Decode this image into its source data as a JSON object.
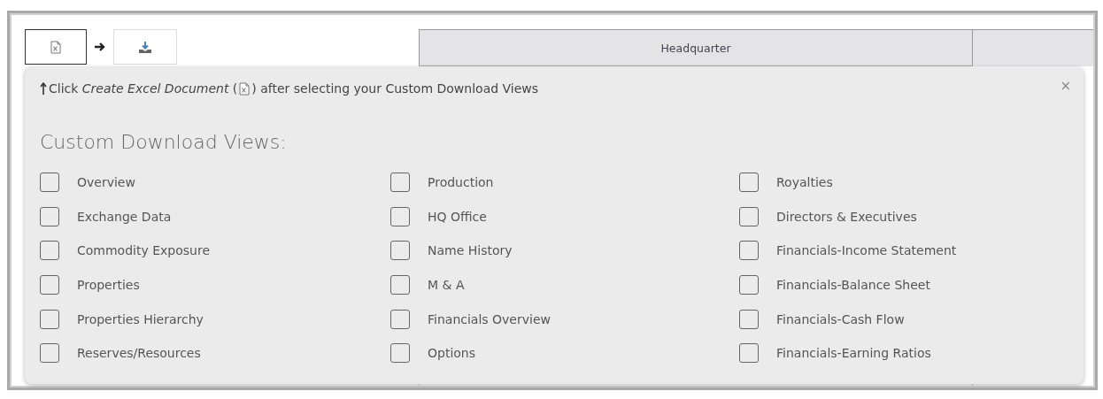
{
  "table": {
    "columns": [
      "Headquarter"
    ]
  },
  "popover": {
    "hint_before": "Click *Create Excel Document* (",
    "hint_after": ") after selecting your Custom Download Views",
    "close": "×",
    "title": "Custom Download Views:",
    "columns": [
      [
        {
          "label": "Overview",
          "checked": false
        },
        {
          "label": "Exchange Data",
          "checked": false
        },
        {
          "label": "Commodity Exposure",
          "checked": false
        },
        {
          "label": "Properties",
          "checked": false
        },
        {
          "label": "Properties Hierarchy",
          "checked": false
        },
        {
          "label": "Reserves/Resources",
          "checked": false
        }
      ],
      [
        {
          "label": "Production",
          "checked": false
        },
        {
          "label": "HQ Office",
          "checked": false
        },
        {
          "label": "Name History",
          "checked": false
        },
        {
          "label": "M & A",
          "checked": false
        },
        {
          "label": "Financials Overview",
          "checked": false
        },
        {
          "label": "Options",
          "checked": false
        }
      ],
      [
        {
          "label": "Royalties",
          "checked": false
        },
        {
          "label": "Directors & Executives",
          "checked": false
        },
        {
          "label": "Financials-Income Statement",
          "checked": false
        },
        {
          "label": "Financials-Balance Sheet",
          "checked": false
        },
        {
          "label": "Financials-Cash Flow",
          "checked": false
        },
        {
          "label": "Financials-Earning Ratios",
          "checked": false
        }
      ]
    ]
  }
}
